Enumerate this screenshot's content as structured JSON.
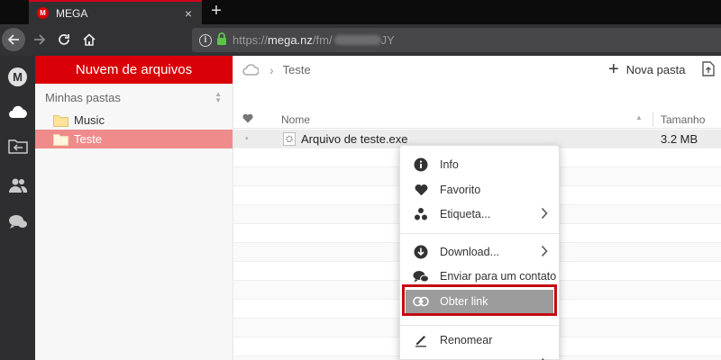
{
  "browser": {
    "tab_title": "MEGA",
    "tab_favicon_letter": "M",
    "tab_close": "×",
    "new_tab": "+",
    "url_prefix": "https://",
    "url_domain": "mega.nz",
    "url_path": "/fm/",
    "url_suffix": "JY"
  },
  "app": {
    "logo_letter": "M",
    "rail_items": [
      "cloud-drive",
      "transfers",
      "contacts",
      "chat"
    ],
    "brand_color": "#d90007"
  },
  "panel": {
    "header": "Nuvem de arquivos",
    "subheader": "Minhas pastas",
    "folders": [
      {
        "name": "Music",
        "selected": false
      },
      {
        "name": "Teste",
        "selected": true
      }
    ]
  },
  "main": {
    "breadcrumb": "Teste",
    "new_folder_label": "Nova pasta",
    "columns": {
      "name": "Nome",
      "size": "Tamanho"
    },
    "files": [
      {
        "name": "Arquivo de teste.exe",
        "size": "3.2 MB"
      }
    ]
  },
  "context_menu": {
    "items": [
      {
        "label": "Info",
        "icon": "info-icon"
      },
      {
        "label": "Favorito",
        "icon": "heart-icon"
      },
      {
        "label": "Etiqueta...",
        "icon": "label-dots-icon",
        "submenu": true
      },
      {
        "label": "Download...",
        "icon": "download-icon",
        "submenu": true
      },
      {
        "label": "Enviar para um contato",
        "icon": "chat-bubbles-icon"
      },
      {
        "label": "Obter link",
        "icon": "link-icon",
        "highlighted": true
      },
      {
        "label": "Renomear",
        "icon": "pencil-icon"
      }
    ]
  }
}
